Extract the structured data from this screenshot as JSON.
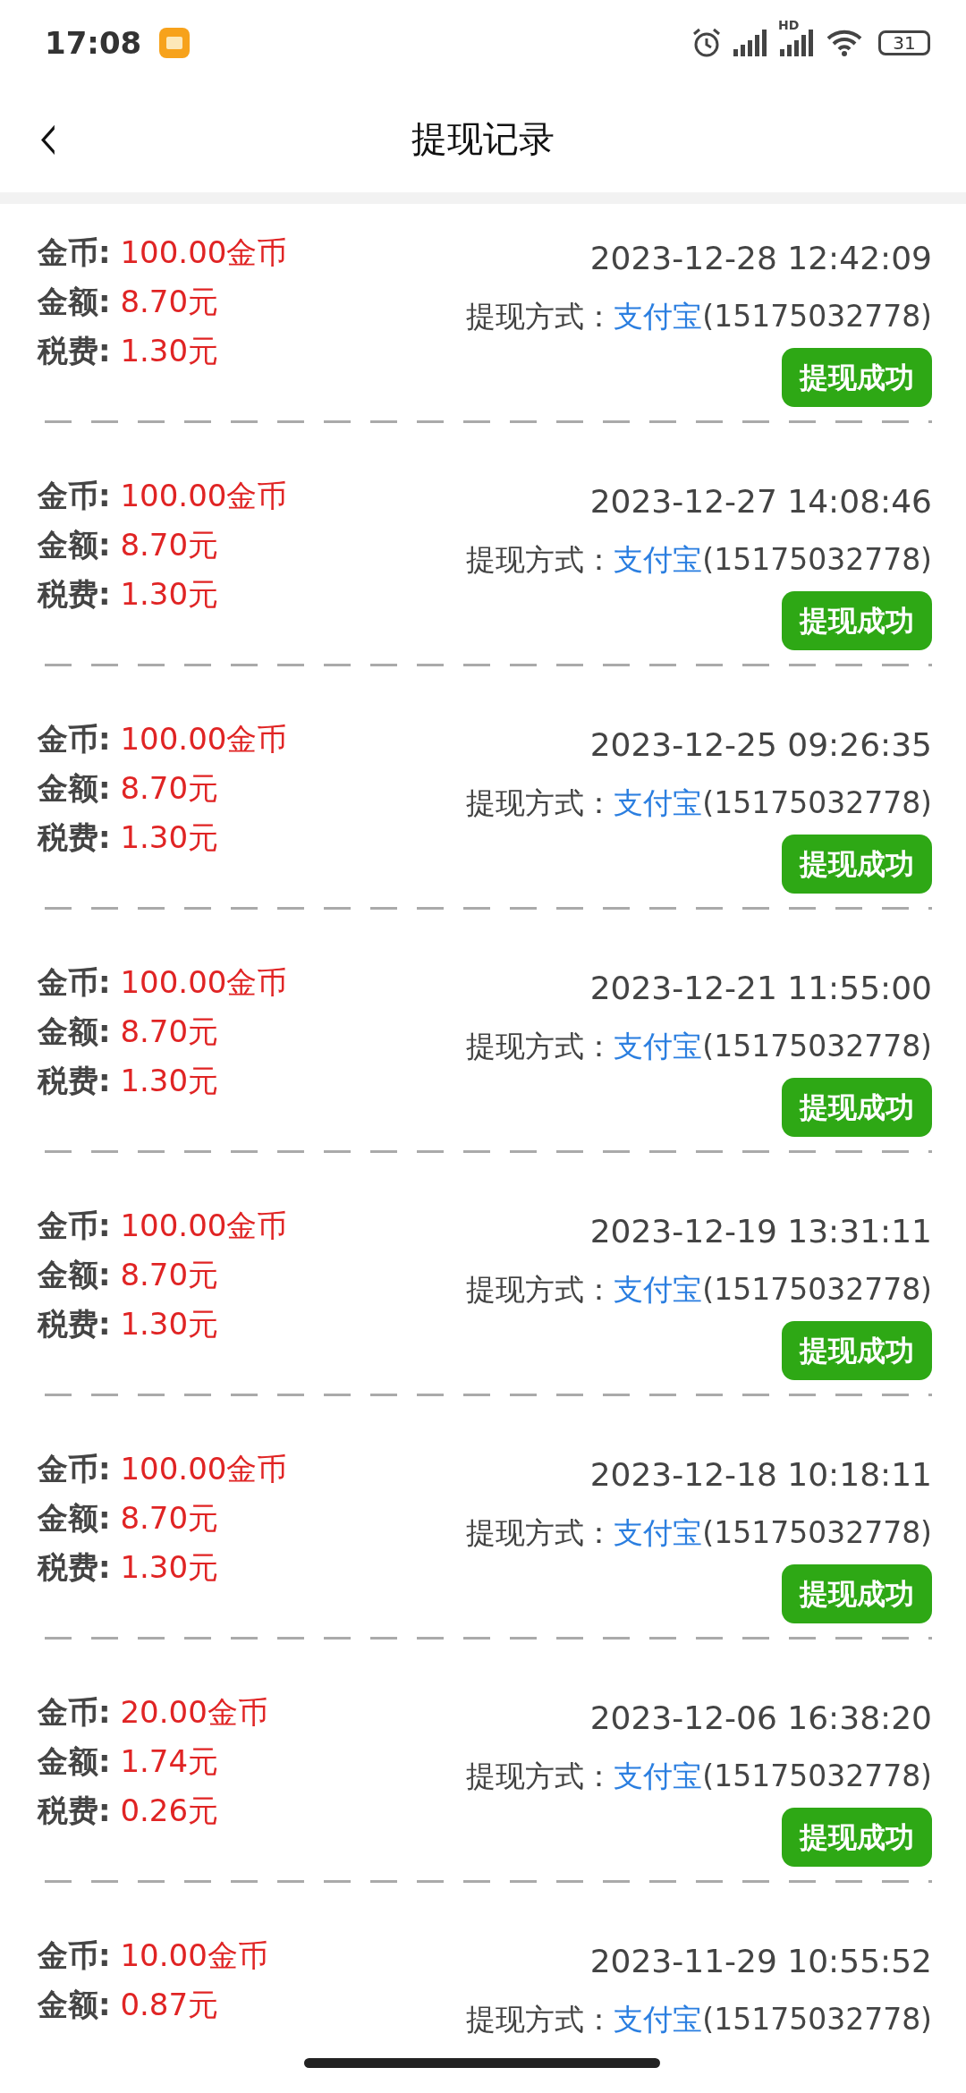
{
  "status_bar": {
    "time": "17:08",
    "network_label": "HD",
    "battery": "31"
  },
  "header": {
    "back": "‹",
    "title": "提现记录"
  },
  "records": [
    {
      "coins_label": "金币:",
      "coins": "100.00金币",
      "amount_label": "金额:",
      "amount": "8.70元",
      "tax_label": "税费:",
      "tax": "1.30元",
      "time": "2023-12-28 12:42:09",
      "method_label": "提现方式：",
      "method": "支付宝",
      "account": "(15175032778)",
      "status": "提现成功"
    },
    {
      "coins_label": "金币:",
      "coins": "100.00金币",
      "amount_label": "金额:",
      "amount": "8.70元",
      "tax_label": "税费:",
      "tax": "1.30元",
      "time": "2023-12-27 14:08:46",
      "method_label": "提现方式：",
      "method": "支付宝",
      "account": "(15175032778)",
      "status": "提现成功"
    },
    {
      "coins_label": "金币:",
      "coins": "100.00金币",
      "amount_label": "金额:",
      "amount": "8.70元",
      "tax_label": "税费:",
      "tax": "1.30元",
      "time": "2023-12-25 09:26:35",
      "method_label": "提现方式：",
      "method": "支付宝",
      "account": "(15175032778)",
      "status": "提现成功"
    },
    {
      "coins_label": "金币:",
      "coins": "100.00金币",
      "amount_label": "金额:",
      "amount": "8.70元",
      "tax_label": "税费:",
      "tax": "1.30元",
      "time": "2023-12-21 11:55:00",
      "method_label": "提现方式：",
      "method": "支付宝",
      "account": "(15175032778)",
      "status": "提现成功"
    },
    {
      "coins_label": "金币:",
      "coins": "100.00金币",
      "amount_label": "金额:",
      "amount": "8.70元",
      "tax_label": "税费:",
      "tax": "1.30元",
      "time": "2023-12-19 13:31:11",
      "method_label": "提现方式：",
      "method": "支付宝",
      "account": "(15175032778)",
      "status": "提现成功"
    },
    {
      "coins_label": "金币:",
      "coins": "100.00金币",
      "amount_label": "金额:",
      "amount": "8.70元",
      "tax_label": "税费:",
      "tax": "1.30元",
      "time": "2023-12-18 10:18:11",
      "method_label": "提现方式：",
      "method": "支付宝",
      "account": "(15175032778)",
      "status": "提现成功"
    },
    {
      "coins_label": "金币:",
      "coins": "20.00金币",
      "amount_label": "金额:",
      "amount": "1.74元",
      "tax_label": "税费:",
      "tax": "0.26元",
      "time": "2023-12-06 16:38:20",
      "method_label": "提现方式：",
      "method": "支付宝",
      "account": "(15175032778)",
      "status": "提现成功"
    },
    {
      "coins_label": "金币:",
      "coins": "10.00金币",
      "amount_label": "金额:",
      "amount": "0.87元",
      "time": "2023-11-29 10:55:52",
      "method_label": "提现方式：",
      "method": "支付宝",
      "account": "(15175032778)"
    }
  ]
}
